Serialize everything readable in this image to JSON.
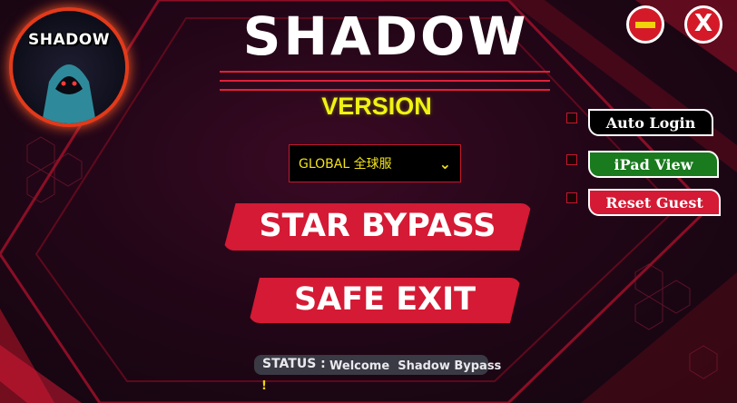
{
  "window": {
    "minimize_icon": "minimize-icon",
    "close_label": "X"
  },
  "logo": {
    "text": "SHADOW"
  },
  "title": "SHADOW",
  "version": "VERSION",
  "region_select": {
    "selected": "GLOBAL 全球服"
  },
  "main_buttons": {
    "start": "STAR BYPASS",
    "exit": "SAFE EXIT"
  },
  "side_buttons": [
    {
      "label": "Auto Login",
      "color": "#000000"
    },
    {
      "label": "iPad View",
      "color": "#1a7a1e"
    },
    {
      "label": "Reset Guest",
      "color": "#d41a34"
    }
  ],
  "status": {
    "key": "STATUS :",
    "text": "Welcome  Shadow Bypass",
    "tail": "!"
  },
  "colors": {
    "accent": "#d41a34",
    "highlight": "#f2f214"
  }
}
